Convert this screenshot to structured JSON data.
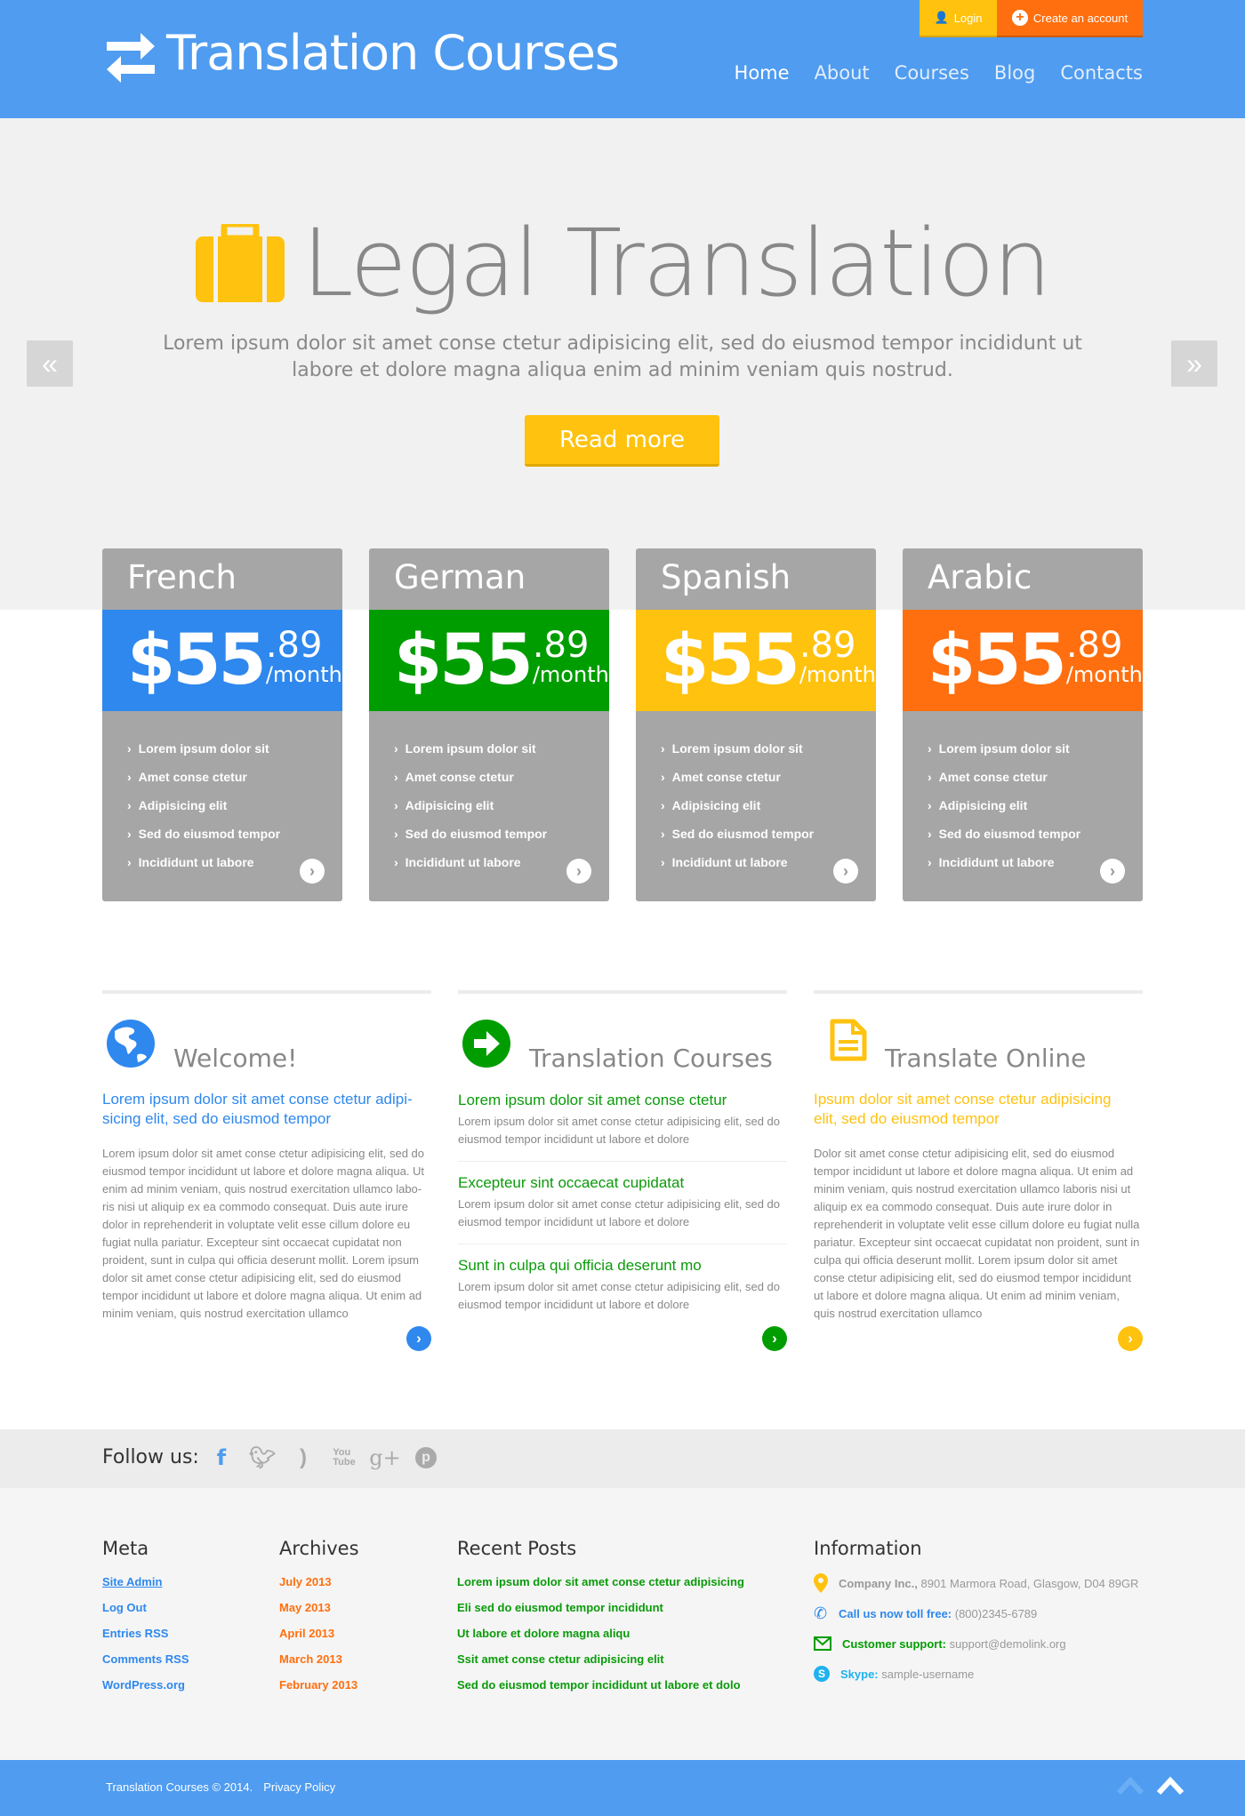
{
  "colors": {
    "header": "#4f9cf0",
    "blue": "#2e88ee",
    "green": "#009d00",
    "yellow": "#ffc20e",
    "orange": "#ff6f0f",
    "gray": "#a6a6a6"
  },
  "header": {
    "logo": "Translation Courses",
    "login": "Login",
    "create_account": "Create an account",
    "nav": [
      "Home",
      "About",
      "Courses",
      "Blog",
      "Contacts"
    ]
  },
  "hero": {
    "title": "Legal Translation",
    "text": "Lorem ipsum dolor sit amet conse ctetur adipisicing elit, sed do eiusmod tempor incididunt ut labore et dolore magna aliqua enim ad minim veniam quis nostrud.",
    "button": "Read more",
    "prev": "«",
    "next": "»"
  },
  "pricing": [
    {
      "lang": "French",
      "price": "$55",
      "cents": ".89",
      "per": "/month",
      "color": "#2e88ee",
      "items": [
        "Lorem ipsum dolor sit",
        "Amet conse ctetur",
        "Adipisicing elit",
        "Sed do eiusmod tempor",
        "Incididunt ut labore"
      ]
    },
    {
      "lang": "German",
      "price": "$55",
      "cents": ".89",
      "per": "/month",
      "color": "#009d00",
      "items": [
        "Lorem ipsum dolor sit",
        "Amet conse ctetur",
        "Adipisicing elit",
        "Sed do eiusmod tempor",
        "Incididunt ut labore"
      ]
    },
    {
      "lang": "Spanish",
      "price": "$55",
      "cents": ".89",
      "per": "/month",
      "color": "#ffc20e",
      "items": [
        "Lorem ipsum dolor sit",
        "Amet conse ctetur",
        "Adipisicing elit",
        "Sed do eiusmod tempor",
        "Incididunt ut labore"
      ]
    },
    {
      "lang": "Arabic",
      "price": "$55",
      "cents": ".89",
      "per": "/month",
      "color": "#ff6f0f",
      "items": [
        "Lorem ipsum dolor sit",
        "Amet conse ctetur",
        "Adipisicing elit",
        "Sed do eiusmod tempor",
        "Incididunt ut labore"
      ]
    }
  ],
  "features": {
    "welcome": {
      "title": "Welcome!",
      "lead": "Lorem ipsum dolor sit amet conse ctetur adipi-sicing elit, sed do eiusmod tempor",
      "body": "Lorem ipsum dolor sit amet conse ctetur adipisicing elit, sed do eiusmod tempor incididunt ut labore et dolore magna aliqua. Ut enim ad minim veniam, quis nostrud exercitation ullamco labo-ris nisi ut aliquip ex ea commodo consequat. Duis aute irure dolor in reprehenderit in voluptate velit esse cillum dolore eu fugiat nulla pariatur. Excepteur sint occaecat cupidatat non proident, sunt in culpa qui officia deserunt mollit. Lorem ipsum dolor sit amet conse ctetur adipisicing elit, sed do eiusmod tempor incididunt ut labore et dolore magna aliqua. Ut enim ad minim veniam, quis nostrud exercitation ullamco"
    },
    "courses": {
      "title": "Translation Courses",
      "posts": [
        {
          "title": "Lorem ipsum dolor sit amet conse ctetur",
          "text": "Lorem ipsum dolor sit amet conse ctetur adipisicing elit, sed do eiusmod tempor incididunt ut labore et dolore"
        },
        {
          "title": "Excepteur sint occaecat cupidatat",
          "text": "Lorem ipsum dolor sit amet conse ctetur adipisicing elit, sed do eiusmod tempor incididunt ut labore et dolore"
        },
        {
          "title": "Sunt in culpa qui officia deserunt mo",
          "text": "Lorem ipsum dolor sit amet conse ctetur adipisicing elit, sed do eiusmod tempor incididunt ut labore et dolore"
        }
      ]
    },
    "online": {
      "title": "Translate Online",
      "lead": "Ipsum dolor sit amet conse ctetur adipisicing elit, sed do eiusmod tempor",
      "body": "Dolor sit amet conse ctetur adipisicing elit, sed do eiusmod tempor incididunt ut labore et dolore magna aliqua. Ut enim ad minim veniam, quis nostrud exercitation ullamco laboris nisi ut aliquip ex ea commodo consequat. Duis aute irure dolor in reprehenderit in voluptate velit esse cillum dolore eu fugiat nulla pariatur. Excepteur sint occaecat cupidatat non proident, sunt in culpa qui officia deserunt mollit. Lorem ipsum dolor sit amet conse ctetur adipisicing elit, sed do eiusmod tempor incididunt ut labore et dolore magna aliqua. Ut enim ad minim veniam, quis nostrud exercitation ullamco"
    }
  },
  "follow": {
    "label": "Follow us:",
    "icons": [
      "facebook-icon",
      "twitter-icon",
      "rss-icon",
      "youtube-icon",
      "google-plus-icon",
      "pinterest-icon"
    ]
  },
  "footer": {
    "meta": {
      "title": "Meta",
      "links": [
        "Site Admin",
        "Log Out",
        "Entries RSS",
        "Comments RSS",
        "WordPress.org"
      ]
    },
    "archives": {
      "title": "Archives",
      "links": [
        "July 2013",
        "May 2013",
        "April 2013",
        "March 2013",
        "February 2013"
      ]
    },
    "recent": {
      "title": "Recent Posts",
      "links": [
        "Lorem ipsum dolor sit amet conse ctetur adipisicing",
        "Eli sed do eiusmod tempor incididunt",
        "Ut labore et dolore magna aliqu",
        "Ssit amet conse ctetur adipisicing elit",
        "Sed do eiusmod tempor incididunt ut labore et dolo"
      ]
    },
    "info": {
      "title": "Information",
      "company_label": "Company Inc.,",
      "company": "8901 Marmora Road, Glasgow, D04 89GR",
      "phone_label": "Call us now toll free:",
      "phone": "(800)2345-6789",
      "support_label": "Customer support:",
      "support": "support@demolink.org",
      "skype_label": "Skype:",
      "skype": "sample-username"
    }
  },
  "bottom": {
    "copyright": "Translation Courses © 2014.",
    "privacy": "Privacy Policy"
  }
}
